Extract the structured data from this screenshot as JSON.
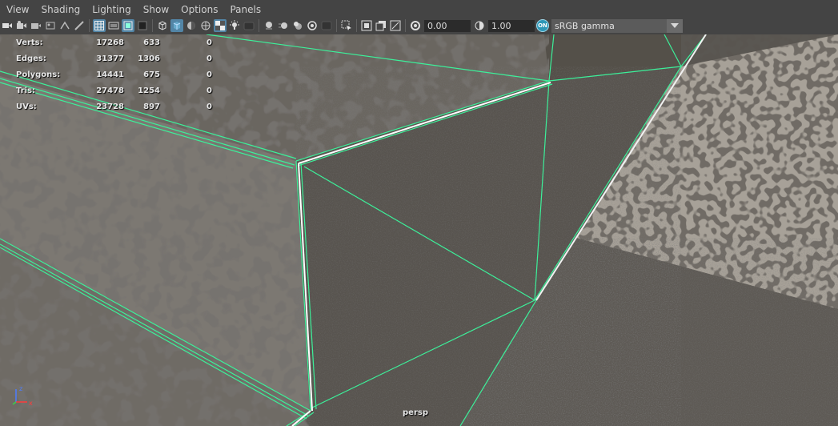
{
  "menubar": {
    "items": [
      "View",
      "Shading",
      "Lighting",
      "Show",
      "Options",
      "Panels"
    ]
  },
  "toolbar": {
    "exposure_value": "0.00",
    "gamma_value": "1.00",
    "color_management_badge": "ON",
    "colorspace_selected": "sRGB gamma"
  },
  "hud": {
    "rows": [
      {
        "label": "Verts:",
        "v1": "17268",
        "v2": "633",
        "v3": "0"
      },
      {
        "label": "Edges:",
        "v1": "31377",
        "v2": "1306",
        "v3": "0"
      },
      {
        "label": "Polygons:",
        "v1": "14441",
        "v2": "675",
        "v3": "0"
      },
      {
        "label": "Tris:",
        "v1": "27478",
        "v2": "1254",
        "v3": "0"
      },
      {
        "label": "UVs:",
        "v1": "23728",
        "v2": "897",
        "v3": "0"
      }
    ]
  },
  "viewport": {
    "camera_label": "persp",
    "wire_color": "#3cf09a",
    "axis_labels": {
      "z": "z",
      "x": "x"
    }
  }
}
